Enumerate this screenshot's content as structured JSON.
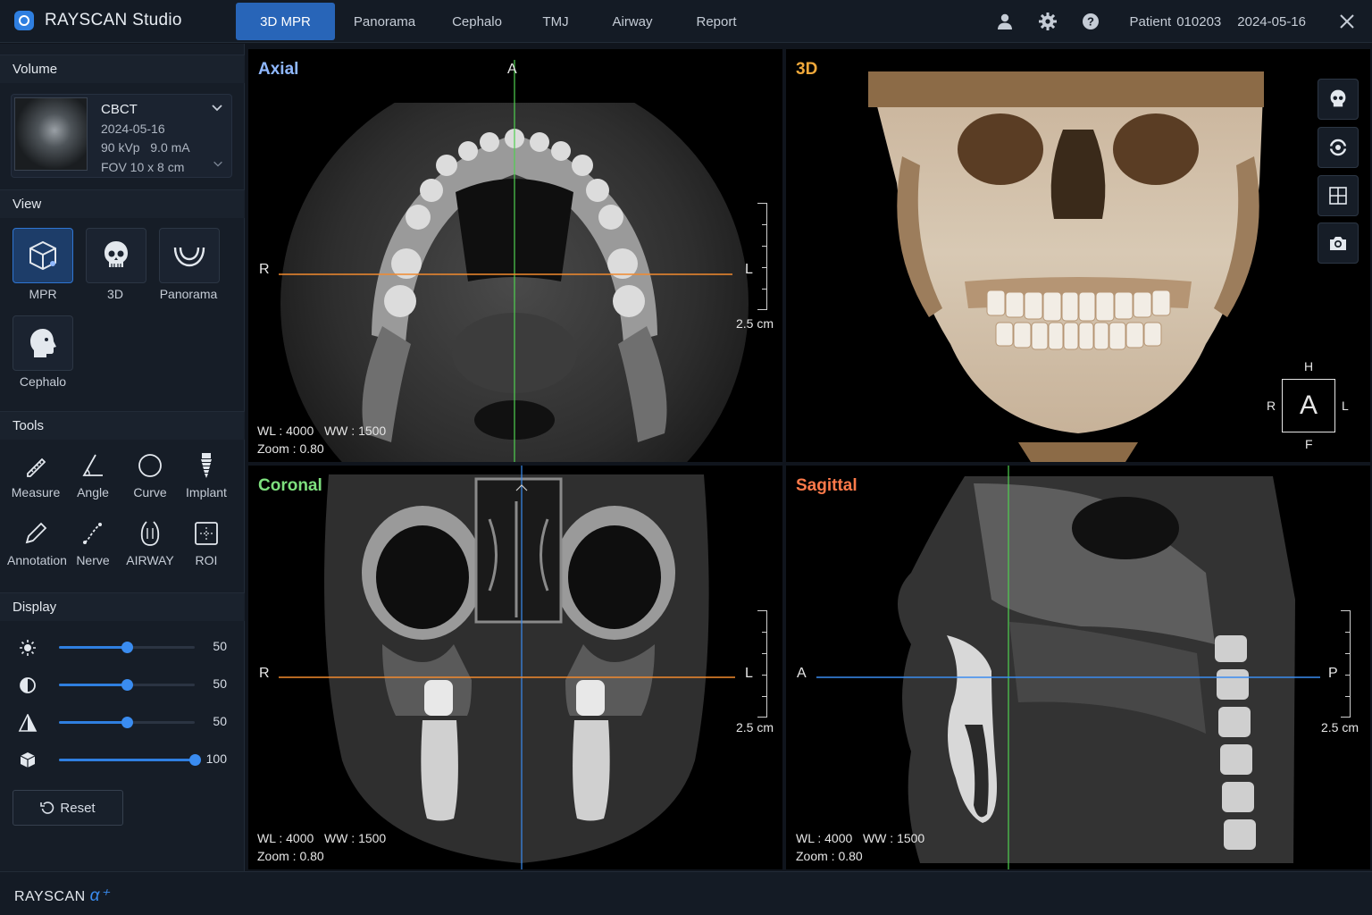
{
  "app": {
    "title": "RAYSCAN Studio",
    "brand": "RAYSCAN",
    "brand_suffix": "α⁺"
  },
  "tabs": [
    "3D MPR",
    "Panorama",
    "Cephalo",
    "TMJ",
    "Airway",
    "Report"
  ],
  "active_tab": "3D MPR",
  "header": {
    "patient_label": "Patient",
    "patient_id": "010203",
    "date": "2024-05-16"
  },
  "sidebar": {
    "volume_title": "Volume",
    "volume": {
      "name": "CBCT",
      "date": "2024-05-16",
      "kvp": "90 kVp",
      "ma": "9.0 mA",
      "fov": "FOV 10 x 8 cm"
    },
    "view_title": "View",
    "views": [
      "MPR",
      "3D",
      "Panorama",
      "Cephalo"
    ],
    "tools_title": "Tools",
    "tools": [
      "Measure",
      "Angle",
      "Curve",
      "Implant",
      "Annotation",
      "Nerve",
      "AIRWAY",
      "ROI"
    ],
    "display_title": "Display",
    "display": [
      {
        "icon": "brightness-icon",
        "value": 50,
        "level": 0.5
      },
      {
        "icon": "contrast-icon",
        "value": 50,
        "level": 0.5
      },
      {
        "icon": "sharpness-icon",
        "value": 50,
        "level": 0.5
      },
      {
        "icon": "volume-cube-icon",
        "value": 100,
        "level": 1.0
      }
    ],
    "reset_label": "Reset"
  },
  "viewports": {
    "axial": {
      "title": "Axial",
      "color": "#8fb8ff",
      "wl": "WL : 4000",
      "ww": "WW : 1500",
      "zoom": "Zoom : 0.80",
      "top": "A",
      "left": "R",
      "right": "L",
      "scale": "2.5 cm"
    },
    "three_d": {
      "title": "3D",
      "color": "#f0a83a",
      "cube_face": "A",
      "cube_top": "H",
      "cube_bottom": "F",
      "cube_left": "R",
      "cube_right": "L"
    },
    "coronal": {
      "title": "Coronal",
      "color": "#7ee07e",
      "wl": "WL : 4000",
      "ww": "WW : 1500",
      "zoom": "Zoom : 0.80",
      "left": "R",
      "right": "L",
      "scale": "2.5 cm"
    },
    "sagittal": {
      "title": "Sagittal",
      "color": "#ff7a4a",
      "wl": "WL : 4000",
      "ww": "WW : 1500",
      "zoom": "Zoom : 0.80",
      "left": "A",
      "right": "P",
      "scale": "2.5 cm"
    }
  },
  "colors": {
    "accent": "#2f7fe0",
    "axial_line": "#f28a2e",
    "coronal_line": "#3a8cf0",
    "sagittal_line": "#4fd04f"
  }
}
